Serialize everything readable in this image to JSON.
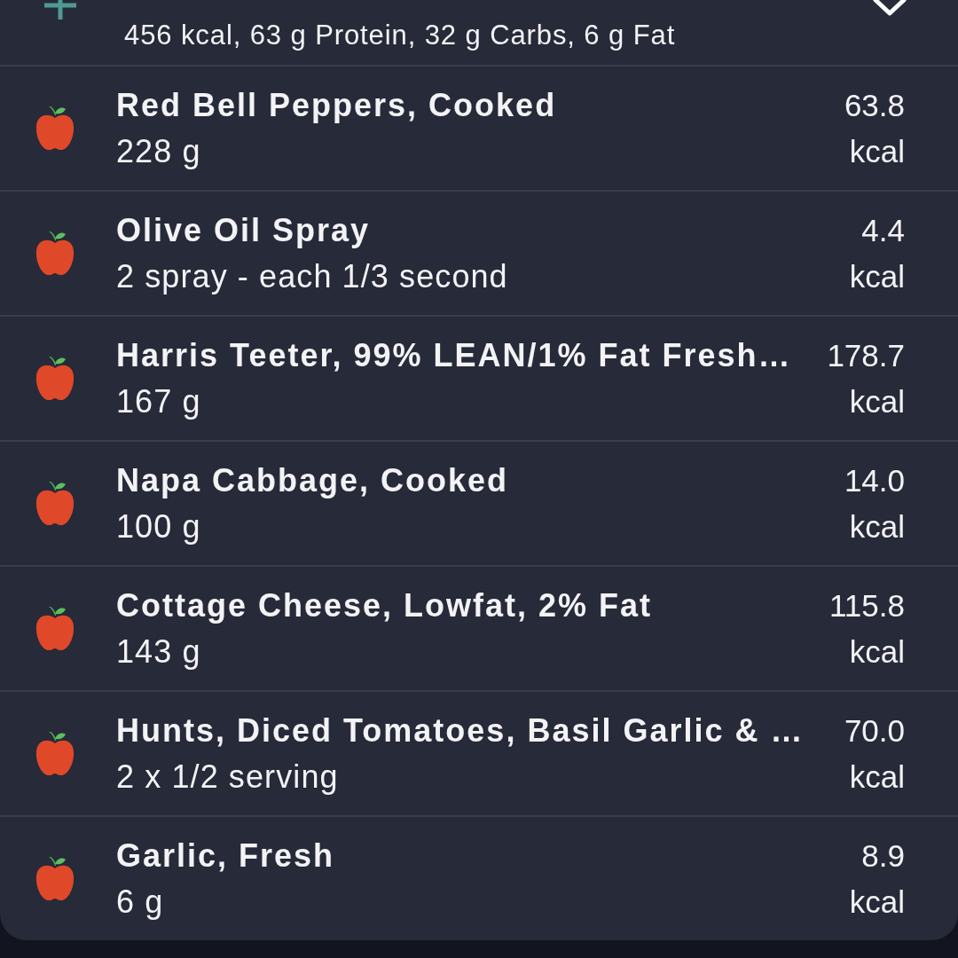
{
  "meal": {
    "summary": "456 kcal, 63 g Protein, 32 g Carbs, 6 g Fat"
  },
  "foods": [
    {
      "name": "Red Bell Peppers, Cooked",
      "amount": "228 g",
      "calories": "63.8",
      "unit": "kcal"
    },
    {
      "name": "Olive Oil Spray",
      "amount": "2 spray - each 1/3 second",
      "calories": "4.4",
      "unit": "kcal"
    },
    {
      "name": "Harris Teeter, 99% LEAN/1% Fat Fresh…",
      "amount": "167 g",
      "calories": "178.7",
      "unit": "kcal"
    },
    {
      "name": "Napa Cabbage, Cooked",
      "amount": "100 g",
      "calories": "14.0",
      "unit": "kcal"
    },
    {
      "name": "Cottage Cheese, Lowfat, 2% Fat",
      "amount": "143 g",
      "calories": "115.8",
      "unit": "kcal"
    },
    {
      "name": "Hunts, Diced Tomatoes, Basil Garlic & …",
      "amount": "2 x 1/2 serving",
      "calories": "70.0",
      "unit": "kcal"
    },
    {
      "name": "Garlic, Fresh",
      "amount": "6 g",
      "calories": "8.9",
      "unit": "kcal"
    }
  ]
}
